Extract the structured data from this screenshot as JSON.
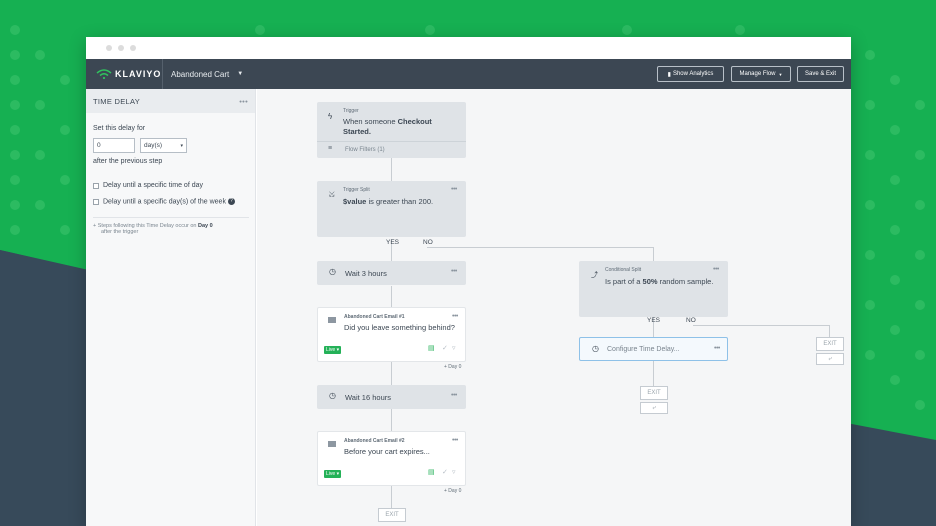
{
  "window": {
    "brand": "KLAVIYO",
    "flow_name": "Abandoned Cart",
    "buttons": {
      "analytics": "Show Analytics",
      "manage": "Manage Flow",
      "save": "Save & Exit"
    }
  },
  "sidebar": {
    "title": "TIME DELAY",
    "set_delay": "Set this delay for",
    "delay_value": "0",
    "delay_unit": "day(s)",
    "after": "after the previous step",
    "opt1": "Delay until a specific time of day",
    "opt2": "Delay until a specific day(s) of the week",
    "note_line1": "Steps following this Time Delay occur on ",
    "note_day": "Day 0",
    "note_line2": "after the trigger"
  },
  "canvas": {
    "trigger": {
      "label": "Trigger",
      "text1": "When someone ",
      "bold": "Checkout",
      "text2": "Started.",
      "filters": "Flow Filters (1)"
    },
    "trigger_split": {
      "label": "Trigger Split",
      "bold": "$value",
      "text": " is greater than 200."
    },
    "yes": "YES",
    "no": "NO",
    "wait1": "Wait 3 hours",
    "email1": {
      "label": "Abandoned Cart Email #1",
      "text": "Did you leave something behind?",
      "status": "Live",
      "day": "+ Day 0"
    },
    "wait2": "Wait 16 hours",
    "email2": {
      "label": "Abandoned Cart Email #2",
      "text": "Before your cart expires...",
      "status": "Live",
      "day": "+ Day 0"
    },
    "cond_split": {
      "label": "Conditional Split",
      "text1": "Is part of a ",
      "bold": "50%",
      "text2": " random sample."
    },
    "yes2": "YES",
    "no2": "NO",
    "config": "Configure Time Delay...",
    "exit": "EXIT"
  }
}
